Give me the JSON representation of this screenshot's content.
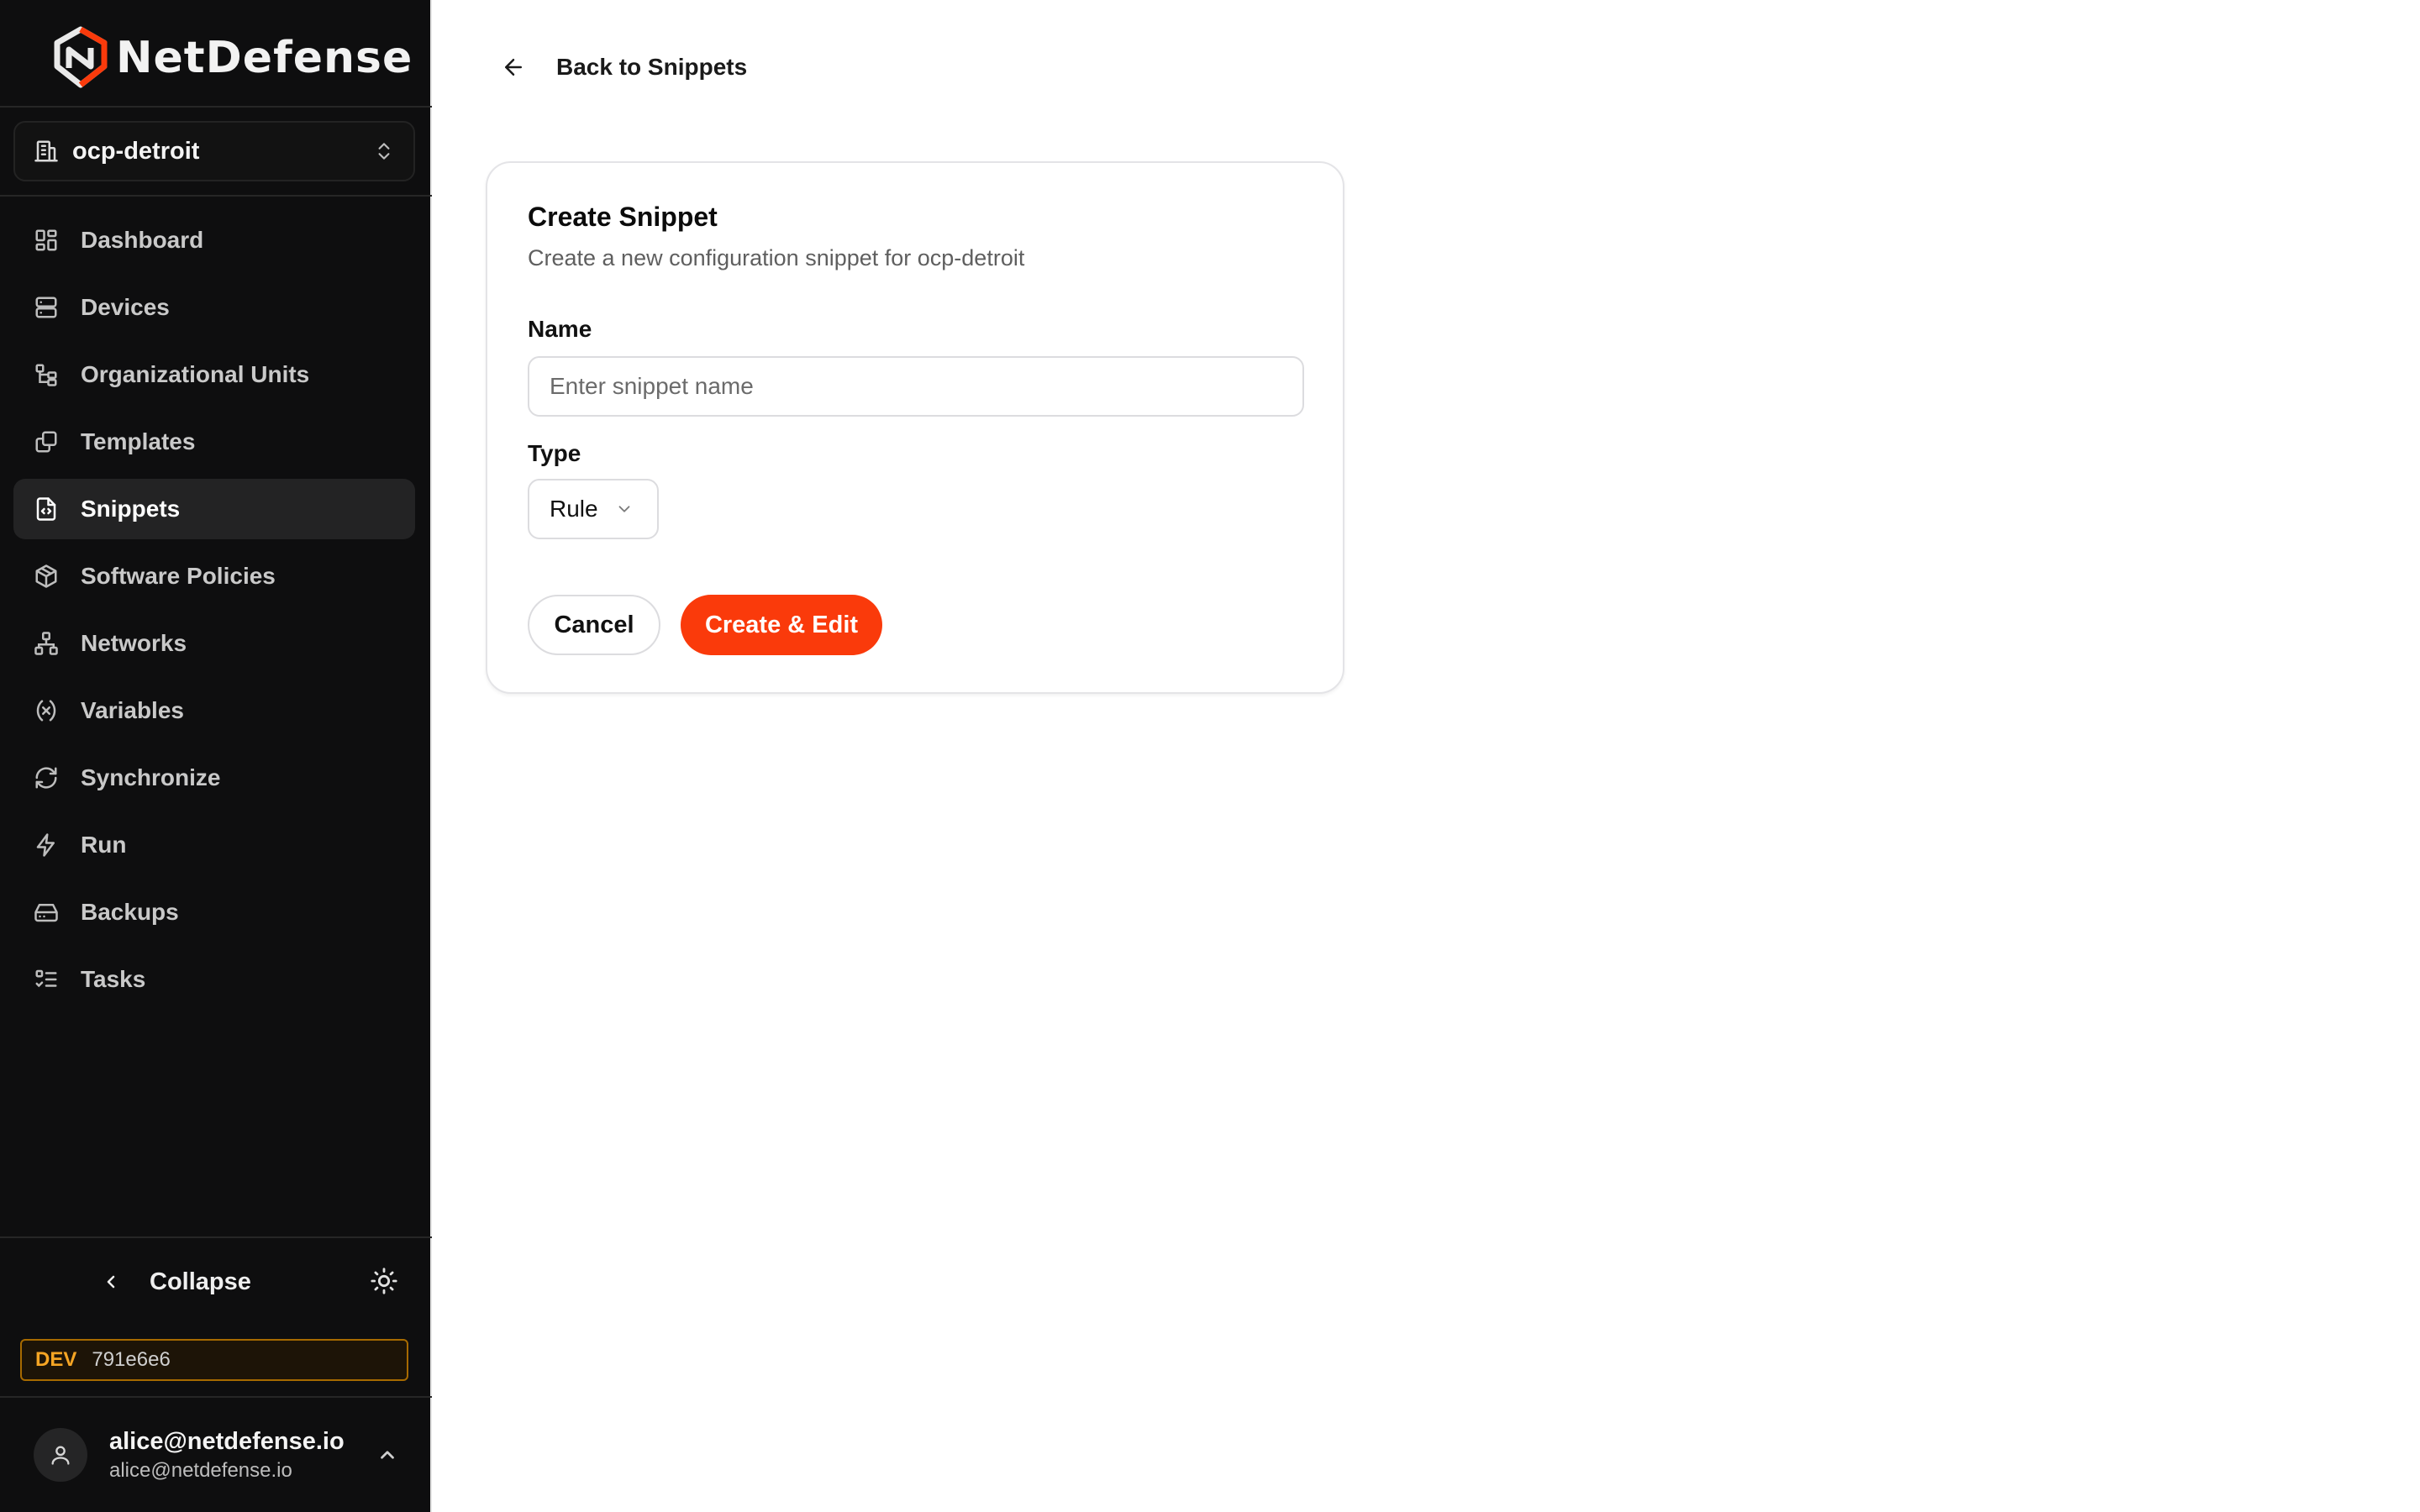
{
  "brand": {
    "name": "NetDefense",
    "accent": "#fa3a0b"
  },
  "org_selector": {
    "value": "ocp-detroit"
  },
  "sidebar": {
    "items": [
      {
        "label": "Dashboard",
        "icon": "dashboard-icon",
        "active": false
      },
      {
        "label": "Devices",
        "icon": "server-icon",
        "active": false
      },
      {
        "label": "Organizational Units",
        "icon": "tree-icon",
        "active": false
      },
      {
        "label": "Templates",
        "icon": "copy-icon",
        "active": false
      },
      {
        "label": "Snippets",
        "icon": "code-file-icon",
        "active": true
      },
      {
        "label": "Software Policies",
        "icon": "package-icon",
        "active": false
      },
      {
        "label": "Networks",
        "icon": "network-icon",
        "active": false
      },
      {
        "label": "Variables",
        "icon": "variable-icon",
        "active": false
      },
      {
        "label": "Synchronize",
        "icon": "refresh-icon",
        "active": false
      },
      {
        "label": "Run",
        "icon": "zap-icon",
        "active": false
      },
      {
        "label": "Backups",
        "icon": "hard-drive-icon",
        "active": false
      },
      {
        "label": "Tasks",
        "icon": "list-checks-icon",
        "active": false
      }
    ],
    "collapse_label": "Collapse",
    "env_badge": {
      "tag": "DEV",
      "hash": "791e6e6"
    },
    "user": {
      "name": "alice@netdefense.io",
      "email": "alice@netdefense.io"
    }
  },
  "main": {
    "back_label": "Back to Snippets",
    "card": {
      "title": "Create Snippet",
      "subtitle": "Create a new configuration snippet for ocp-detroit",
      "name_label": "Name",
      "name_placeholder": "Enter snippet name",
      "name_value": "",
      "type_label": "Type",
      "type_value": "Rule",
      "cancel_label": "Cancel",
      "submit_label": "Create & Edit"
    }
  }
}
